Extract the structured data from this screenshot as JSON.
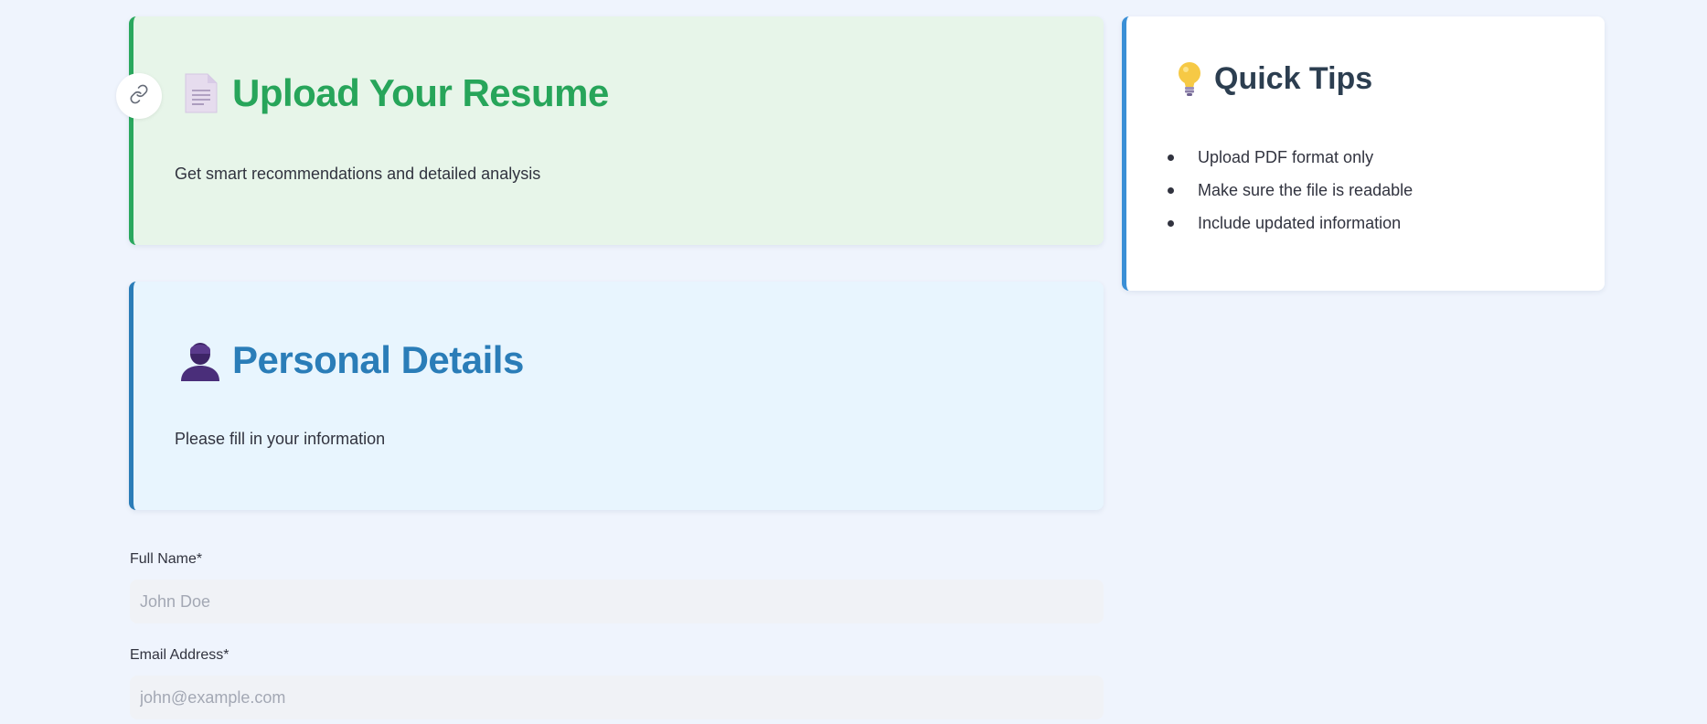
{
  "upload_card": {
    "title": "Upload Your Resume",
    "subtitle": "Get smart recommendations and detailed analysis",
    "icon": "document-icon",
    "accent_color": "#2aa85e"
  },
  "personal_card": {
    "title": "Personal Details",
    "subtitle": "Please fill in your information",
    "icon": "person-icon",
    "accent_color": "#2a7db8"
  },
  "tips_card": {
    "title": "Quick Tips",
    "icon": "lightbulb-icon",
    "accent_color": "#3a8fd6",
    "items": [
      "Upload PDF format only",
      "Make sure the file is readable",
      "Include updated information"
    ]
  },
  "form": {
    "full_name": {
      "label": "Full Name*",
      "value": "",
      "placeholder": "John Doe"
    },
    "email": {
      "label": "Email Address*",
      "value": "",
      "placeholder": "john@example.com"
    }
  },
  "anchor_icon": "link-icon"
}
